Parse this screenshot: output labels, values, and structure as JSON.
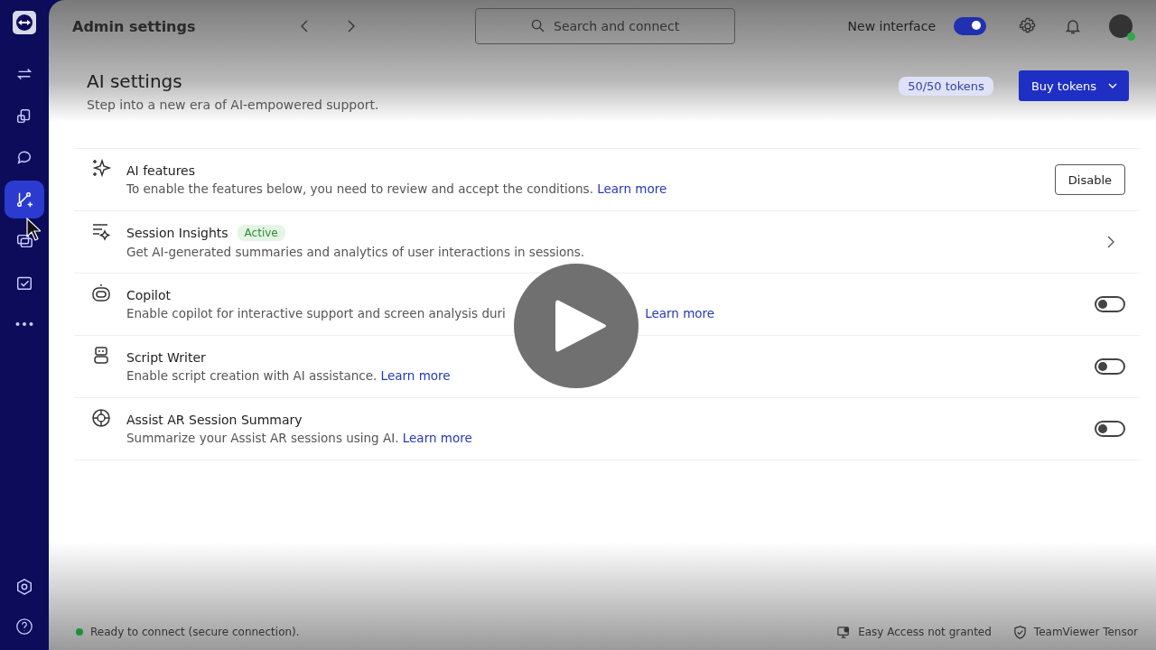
{
  "sidebar": {
    "items": [
      {
        "selected": false
      },
      {
        "selected": false
      },
      {
        "selected": false
      },
      {
        "selected": true
      },
      {
        "selected": false
      },
      {
        "selected": false
      },
      {
        "selected": false
      }
    ]
  },
  "app_bar": {
    "title": "Admin settings",
    "search": {
      "placeholder": "Search and connect"
    },
    "new_interface": {
      "label": "New interface",
      "on": true
    }
  },
  "page": {
    "title": "AI settings",
    "subtitle": "Step into a new era of AI-empowered support.",
    "tokens_badge": "50/50 tokens",
    "buy_button": "Buy tokens"
  },
  "features": [
    {
      "kind": "button",
      "title": "AI features",
      "description": "To enable the features below, you need to review and accept the conditions.",
      "link": "Learn more",
      "button": "Disable"
    },
    {
      "kind": "chevron",
      "title": "Session Insights",
      "badge": "Active",
      "description": "Get AI-generated summaries and analytics of user interactions in sessions."
    },
    {
      "kind": "toggle",
      "title": "Copilot",
      "description": "Enable copilot for interactive support and screen analysis duri",
      "link": "Learn more",
      "on": false,
      "covered": true
    },
    {
      "kind": "toggle",
      "title": "Script Writer",
      "description": "Enable script creation with AI assistance.",
      "link": "Learn more",
      "on": false
    },
    {
      "kind": "toggle",
      "title": "Assist AR Session Summary",
      "description": "Summarize your Assist AR sessions using AI.",
      "link": "Learn more",
      "on": false
    }
  ],
  "status_bar": {
    "online": true,
    "status": "Ready to connect (secure connection).",
    "easy_access": "Easy Access not granted",
    "tensor": "TeamViewer Tensor"
  }
}
